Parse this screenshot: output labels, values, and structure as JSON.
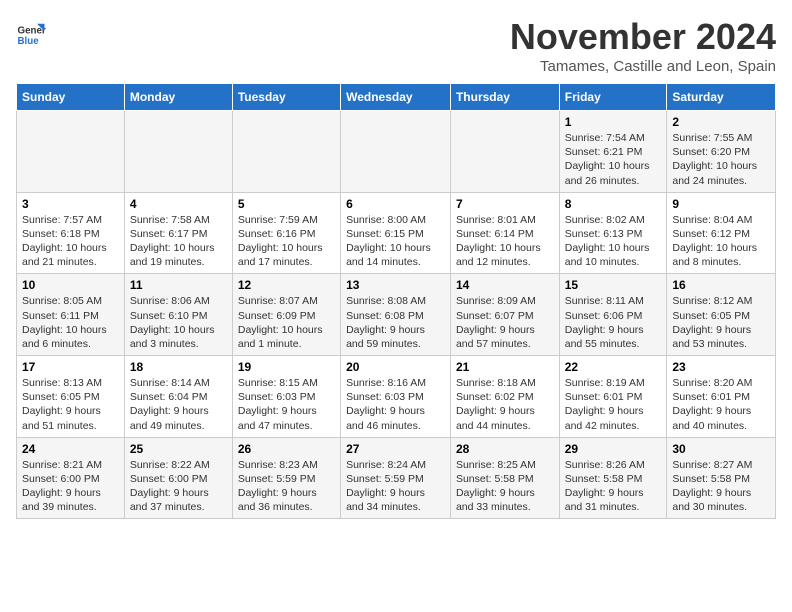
{
  "logo": {
    "line1": "General",
    "line2": "Blue"
  },
  "title": "November 2024",
  "subtitle": "Tamames, Castille and Leon, Spain",
  "days_of_week": [
    "Sunday",
    "Monday",
    "Tuesday",
    "Wednesday",
    "Thursday",
    "Friday",
    "Saturday"
  ],
  "weeks": [
    [
      {
        "day": "",
        "info": ""
      },
      {
        "day": "",
        "info": ""
      },
      {
        "day": "",
        "info": ""
      },
      {
        "day": "",
        "info": ""
      },
      {
        "day": "",
        "info": ""
      },
      {
        "day": "1",
        "info": "Sunrise: 7:54 AM\nSunset: 6:21 PM\nDaylight: 10 hours and 26 minutes."
      },
      {
        "day": "2",
        "info": "Sunrise: 7:55 AM\nSunset: 6:20 PM\nDaylight: 10 hours and 24 minutes."
      }
    ],
    [
      {
        "day": "3",
        "info": "Sunrise: 7:57 AM\nSunset: 6:18 PM\nDaylight: 10 hours and 21 minutes."
      },
      {
        "day": "4",
        "info": "Sunrise: 7:58 AM\nSunset: 6:17 PM\nDaylight: 10 hours and 19 minutes."
      },
      {
        "day": "5",
        "info": "Sunrise: 7:59 AM\nSunset: 6:16 PM\nDaylight: 10 hours and 17 minutes."
      },
      {
        "day": "6",
        "info": "Sunrise: 8:00 AM\nSunset: 6:15 PM\nDaylight: 10 hours and 14 minutes."
      },
      {
        "day": "7",
        "info": "Sunrise: 8:01 AM\nSunset: 6:14 PM\nDaylight: 10 hours and 12 minutes."
      },
      {
        "day": "8",
        "info": "Sunrise: 8:02 AM\nSunset: 6:13 PM\nDaylight: 10 hours and 10 minutes."
      },
      {
        "day": "9",
        "info": "Sunrise: 8:04 AM\nSunset: 6:12 PM\nDaylight: 10 hours and 8 minutes."
      }
    ],
    [
      {
        "day": "10",
        "info": "Sunrise: 8:05 AM\nSunset: 6:11 PM\nDaylight: 10 hours and 6 minutes."
      },
      {
        "day": "11",
        "info": "Sunrise: 8:06 AM\nSunset: 6:10 PM\nDaylight: 10 hours and 3 minutes."
      },
      {
        "day": "12",
        "info": "Sunrise: 8:07 AM\nSunset: 6:09 PM\nDaylight: 10 hours and 1 minute."
      },
      {
        "day": "13",
        "info": "Sunrise: 8:08 AM\nSunset: 6:08 PM\nDaylight: 9 hours and 59 minutes."
      },
      {
        "day": "14",
        "info": "Sunrise: 8:09 AM\nSunset: 6:07 PM\nDaylight: 9 hours and 57 minutes."
      },
      {
        "day": "15",
        "info": "Sunrise: 8:11 AM\nSunset: 6:06 PM\nDaylight: 9 hours and 55 minutes."
      },
      {
        "day": "16",
        "info": "Sunrise: 8:12 AM\nSunset: 6:05 PM\nDaylight: 9 hours and 53 minutes."
      }
    ],
    [
      {
        "day": "17",
        "info": "Sunrise: 8:13 AM\nSunset: 6:05 PM\nDaylight: 9 hours and 51 minutes."
      },
      {
        "day": "18",
        "info": "Sunrise: 8:14 AM\nSunset: 6:04 PM\nDaylight: 9 hours and 49 minutes."
      },
      {
        "day": "19",
        "info": "Sunrise: 8:15 AM\nSunset: 6:03 PM\nDaylight: 9 hours and 47 minutes."
      },
      {
        "day": "20",
        "info": "Sunrise: 8:16 AM\nSunset: 6:03 PM\nDaylight: 9 hours and 46 minutes."
      },
      {
        "day": "21",
        "info": "Sunrise: 8:18 AM\nSunset: 6:02 PM\nDaylight: 9 hours and 44 minutes."
      },
      {
        "day": "22",
        "info": "Sunrise: 8:19 AM\nSunset: 6:01 PM\nDaylight: 9 hours and 42 minutes."
      },
      {
        "day": "23",
        "info": "Sunrise: 8:20 AM\nSunset: 6:01 PM\nDaylight: 9 hours and 40 minutes."
      }
    ],
    [
      {
        "day": "24",
        "info": "Sunrise: 8:21 AM\nSunset: 6:00 PM\nDaylight: 9 hours and 39 minutes."
      },
      {
        "day": "25",
        "info": "Sunrise: 8:22 AM\nSunset: 6:00 PM\nDaylight: 9 hours and 37 minutes."
      },
      {
        "day": "26",
        "info": "Sunrise: 8:23 AM\nSunset: 5:59 PM\nDaylight: 9 hours and 36 minutes."
      },
      {
        "day": "27",
        "info": "Sunrise: 8:24 AM\nSunset: 5:59 PM\nDaylight: 9 hours and 34 minutes."
      },
      {
        "day": "28",
        "info": "Sunrise: 8:25 AM\nSunset: 5:58 PM\nDaylight: 9 hours and 33 minutes."
      },
      {
        "day": "29",
        "info": "Sunrise: 8:26 AM\nSunset: 5:58 PM\nDaylight: 9 hours and 31 minutes."
      },
      {
        "day": "30",
        "info": "Sunrise: 8:27 AM\nSunset: 5:58 PM\nDaylight: 9 hours and 30 minutes."
      }
    ]
  ]
}
